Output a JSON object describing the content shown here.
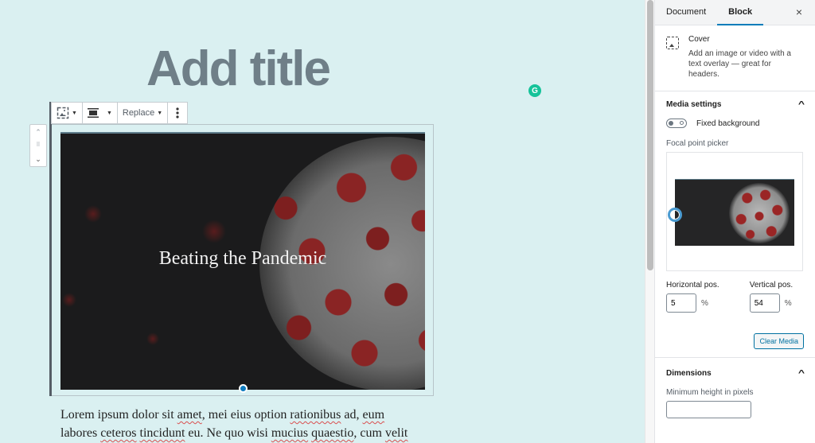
{
  "editor": {
    "title_placeholder": "Add title",
    "toolbar": {
      "block_type_icon": "cover-icon",
      "align_icon": "align-full-icon",
      "replace_label": "Replace",
      "more_icon": "vertical-ellipsis-icon"
    },
    "mover": {
      "up": "⌃",
      "drag": "⠿",
      "down": "⌄"
    },
    "cover": {
      "title": "Beating the Pandemic"
    },
    "paragraph": {
      "line1": [
        "Lorem ipsum dolor sit ",
        "amet",
        ", mei eius option ",
        "rationibus",
        " ad, ",
        "eum"
      ],
      "line2": [
        "labores ",
        "ceteros",
        " ",
        "tincidunt",
        " eu. Ne quo wisi ",
        "mucius",
        " ",
        "quaestio",
        ", cum ",
        "velit"
      ]
    },
    "grammarly_label": "G"
  },
  "sidebar": {
    "tabs": [
      {
        "label": "Document",
        "active": false
      },
      {
        "label": "Block",
        "active": true
      }
    ],
    "close_label": "×",
    "block_card": {
      "name": "Cover",
      "description": "Add an image or video with a text overlay — great for headers."
    },
    "media_settings": {
      "title": "Media settings",
      "fixed_background_label": "Fixed background",
      "fixed_background": false,
      "focal_point_label": "Focal point picker",
      "horizontal_label": "Horizontal pos.",
      "horizontal_value": "5",
      "vertical_label": "Vertical pos.",
      "vertical_value": "54",
      "percent": "%",
      "clear_label": "Clear Media"
    },
    "dimensions": {
      "title": "Dimensions",
      "min_height_label": "Minimum height in pixels",
      "min_height_value": ""
    }
  },
  "colors": {
    "accent": "#007cba",
    "canvas_bg": "#daf0f1",
    "title_gray": "#6f7f88",
    "grammarly": "#15c39a"
  }
}
